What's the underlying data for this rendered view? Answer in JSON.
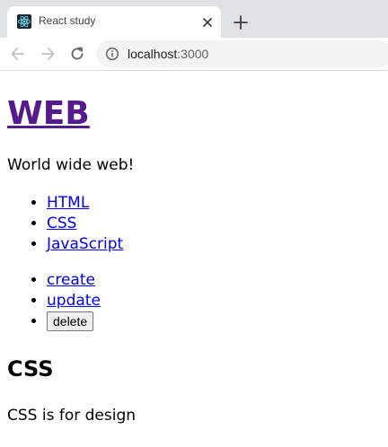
{
  "browser": {
    "tab": {
      "title": "React study",
      "favicon": "react-logo-icon"
    },
    "address": {
      "host": "localhost",
      "port": ":3000"
    },
    "icons": {
      "back": "arrow-left-icon",
      "forward": "arrow-right-icon",
      "reload": "reload-icon",
      "site_info": "info-icon",
      "close_tab": "close-icon",
      "new_tab": "plus-icon"
    },
    "colors": {
      "tabstrip_bg": "#dee1e6",
      "omnibox_bg": "#f1f3f4"
    }
  },
  "page": {
    "title": "WEB",
    "intro": "World wide web!",
    "topics": [
      {
        "label": "HTML"
      },
      {
        "label": "CSS"
      },
      {
        "label": "JavaScript"
      }
    ],
    "controls": {
      "create": "create",
      "update": "update",
      "delete": "delete"
    },
    "article": {
      "title": "CSS",
      "body": "CSS is for design"
    },
    "colors": {
      "visited_link": "#551a8b",
      "link": "#0000ee"
    }
  }
}
